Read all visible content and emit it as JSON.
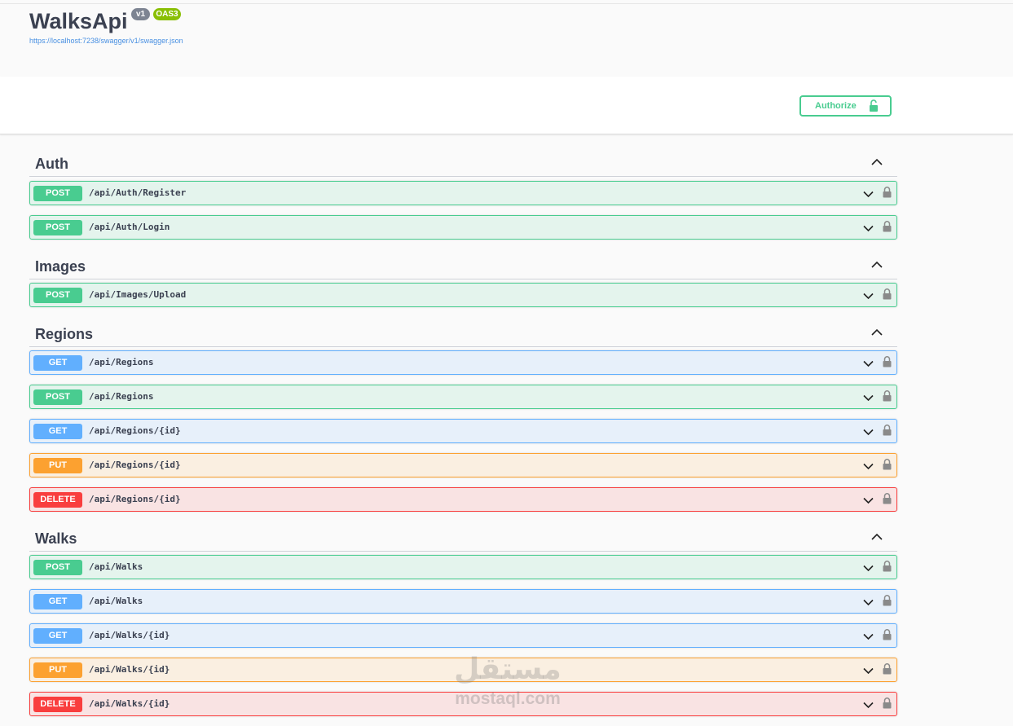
{
  "info": {
    "title": "WalksApi",
    "version": "v1",
    "oas": "OAS3",
    "spec_url": "https://localhost:7238/swagger/v1/swagger.json"
  },
  "authorize": {
    "label": "Authorize"
  },
  "colors": {
    "post": "#49cc90",
    "get": "#61affe",
    "put": "#fca130",
    "delete": "#f93e3e"
  },
  "tags": [
    {
      "name": "Auth",
      "ops": [
        {
          "method": "POST",
          "path": "/api/Auth/Register"
        },
        {
          "method": "POST",
          "path": "/api/Auth/Login"
        }
      ]
    },
    {
      "name": "Images",
      "ops": [
        {
          "method": "POST",
          "path": "/api/Images/Upload"
        }
      ]
    },
    {
      "name": "Regions",
      "ops": [
        {
          "method": "GET",
          "path": "/api/Regions"
        },
        {
          "method": "POST",
          "path": "/api/Regions"
        },
        {
          "method": "GET",
          "path": "/api/Regions/{id}"
        },
        {
          "method": "PUT",
          "path": "/api/Regions/{id}"
        },
        {
          "method": "DELETE",
          "path": "/api/Regions/{id}"
        }
      ]
    },
    {
      "name": "Walks",
      "ops": [
        {
          "method": "POST",
          "path": "/api/Walks"
        },
        {
          "method": "GET",
          "path": "/api/Walks"
        },
        {
          "method": "GET",
          "path": "/api/Walks/{id}"
        },
        {
          "method": "PUT",
          "path": "/api/Walks/{id}"
        },
        {
          "method": "DELETE",
          "path": "/api/Walks/{id}"
        }
      ]
    }
  ],
  "watermark": {
    "arabic": "مستقل",
    "latin": "mostaql.com"
  }
}
